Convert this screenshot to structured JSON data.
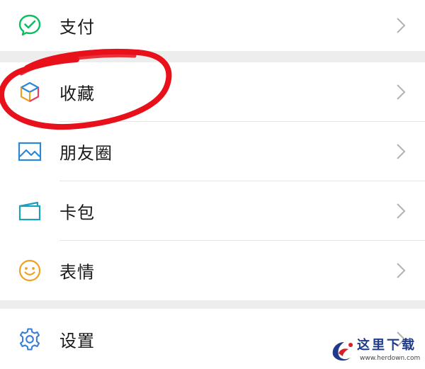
{
  "menu": {
    "pay": {
      "label": "支付",
      "icon": "wechat-pay-icon"
    },
    "favorites": {
      "label": "收藏",
      "icon": "favorites-cube-icon"
    },
    "moments": {
      "label": "朋友圈",
      "icon": "moments-picture-icon"
    },
    "cards": {
      "label": "卡包",
      "icon": "card-wallet-icon"
    },
    "stickers": {
      "label": "表情",
      "icon": "smiley-icon"
    },
    "settings": {
      "label": "设置",
      "icon": "gear-icon"
    }
  },
  "annotation": {
    "color": "#e8101a",
    "target": "favorites"
  },
  "watermark": {
    "title": "这里下载",
    "url": "www.herdown.com"
  },
  "colors": {
    "pay_green": "#07c160",
    "moments_blue": "#2b88d8",
    "card_teal": "#1a9fbf",
    "sticker_yellow": "#f0a020",
    "settings_blue": "#3a7dd8",
    "annotation_red": "#e8101a"
  }
}
